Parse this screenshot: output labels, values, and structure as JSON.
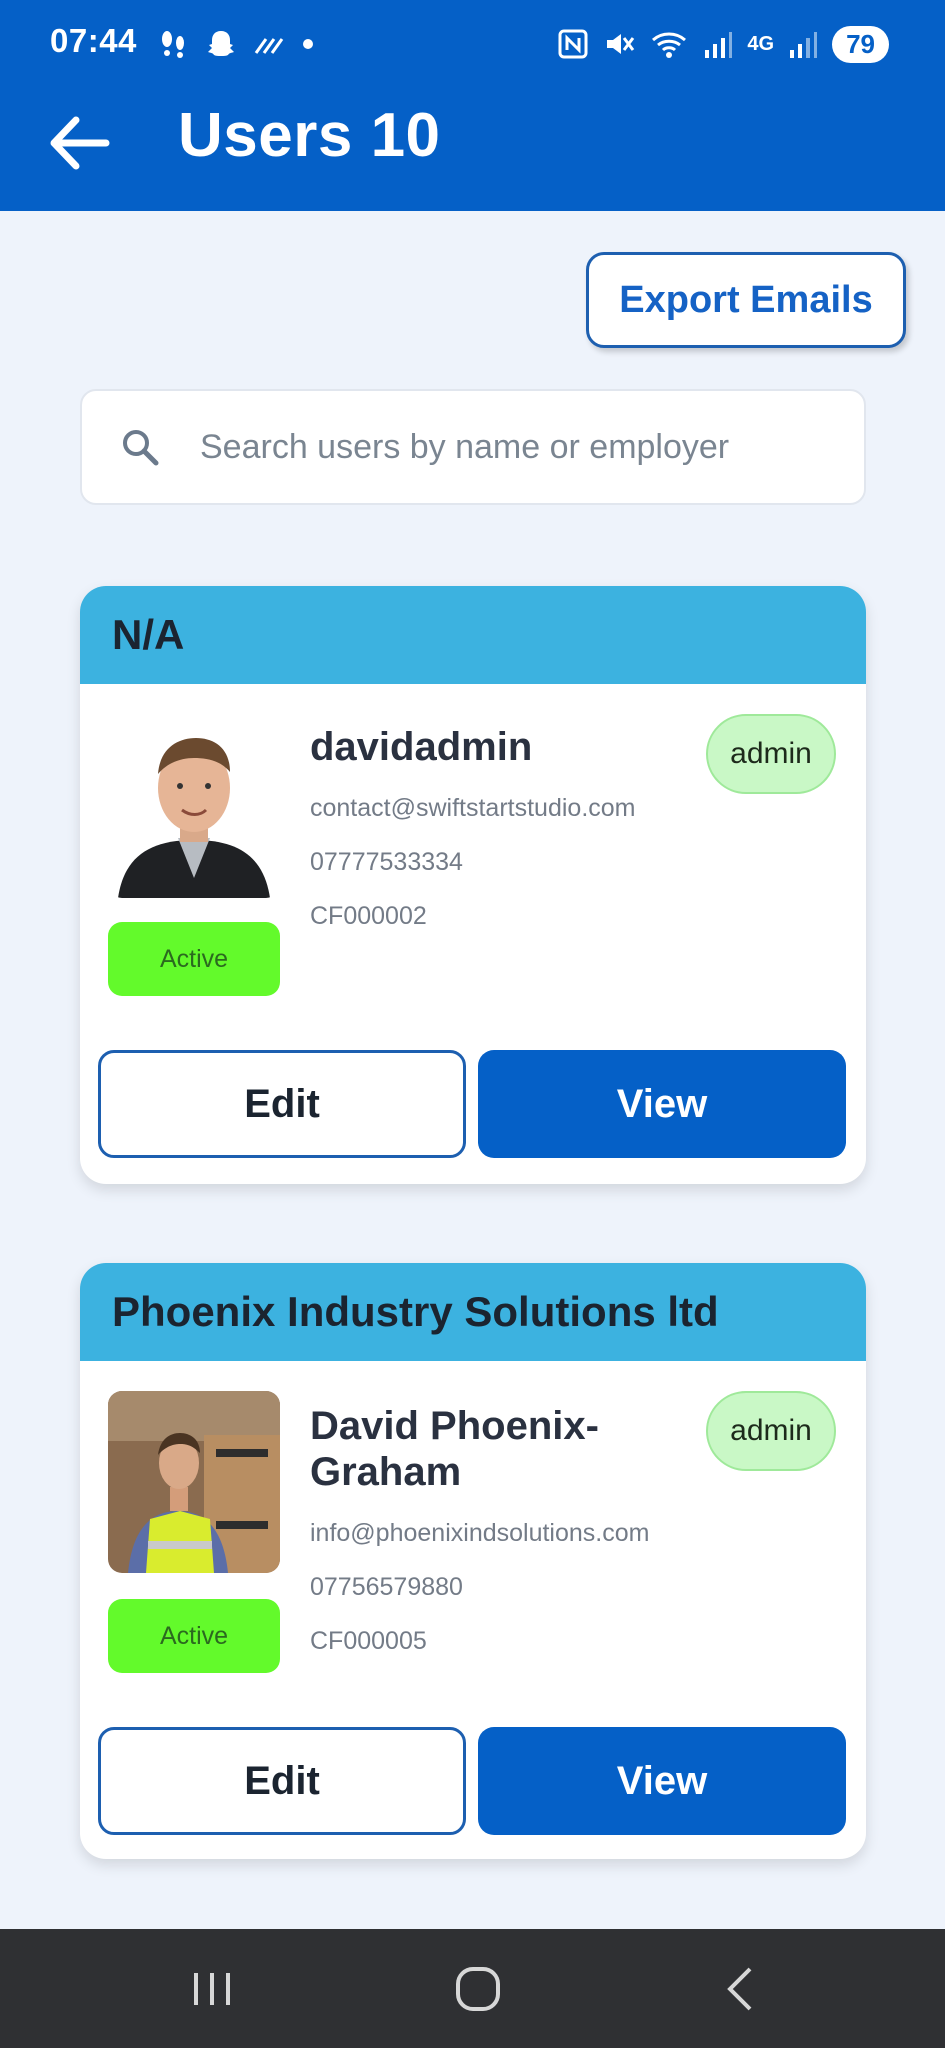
{
  "status_bar": {
    "time": "07:44",
    "battery": "79",
    "network": "4G",
    "left_icons": [
      "footprints-icon",
      "snapchat-icon",
      "signal-icon",
      "dot-icon"
    ],
    "right_icons": [
      "nfc-icon",
      "mute-icon",
      "wifi-icon",
      "cell-signal-icon",
      "cell-signal-icon"
    ]
  },
  "header": {
    "title": "Users 10"
  },
  "actions": {
    "export_label": "Export Emails"
  },
  "search": {
    "placeholder": "Search users by name or employer"
  },
  "users": [
    {
      "employer": "N/A",
      "name": "davidadmin",
      "email": "contact@swiftstartstudio.com",
      "phone": "07777533334",
      "code": "CF000002",
      "status": "Active",
      "role": "admin",
      "edit_label": "Edit",
      "view_label": "View"
    },
    {
      "employer": "Phoenix Industry Solutions ltd",
      "name": "David Phoenix-Graham",
      "email": "info@phoenixindsolutions.com",
      "phone": "07756579880",
      "code": "CF000005",
      "status": "Active",
      "role": "admin",
      "edit_label": "Edit",
      "view_label": "View"
    }
  ],
  "colors": {
    "primary": "#0560c7",
    "card_header": "#3cb2e0",
    "active_badge": "#63fa2b",
    "role_badge": "#c9f8c6",
    "background": "#eef3fb"
  }
}
